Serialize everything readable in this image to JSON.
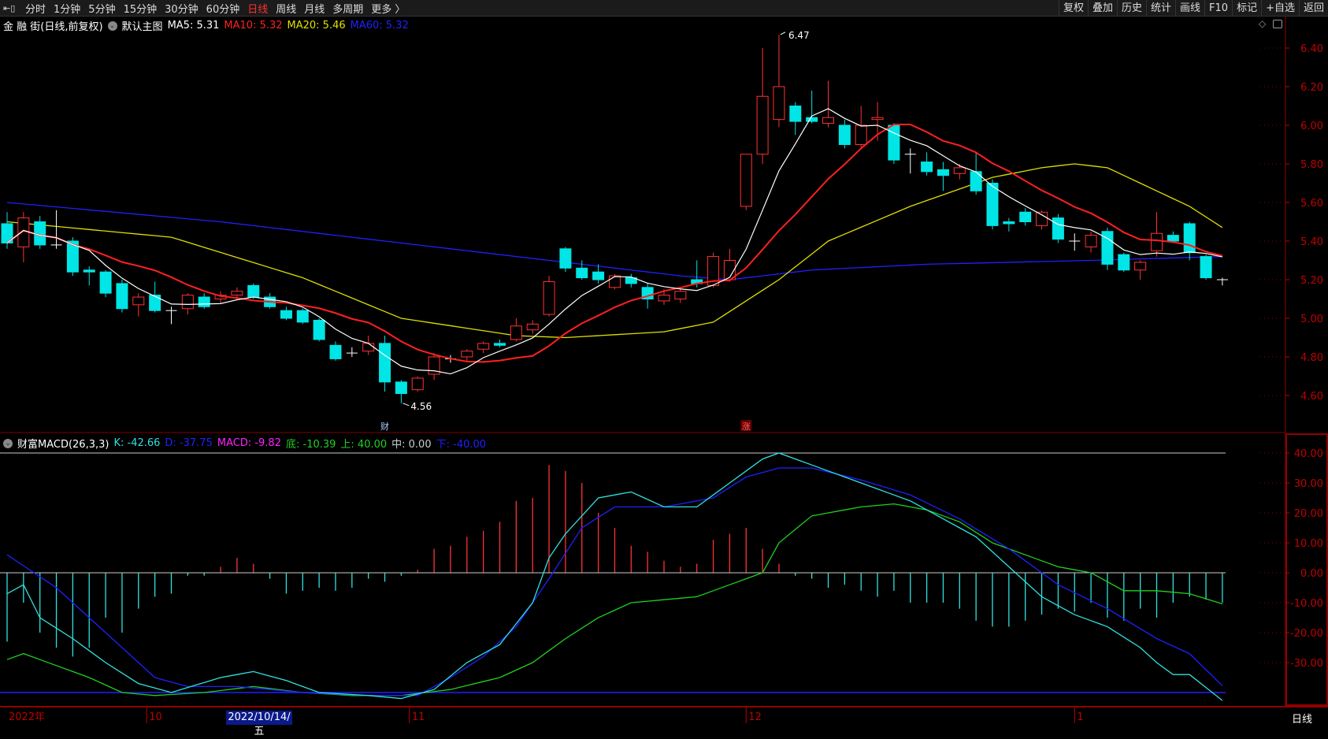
{
  "toolbar": {
    "periods": [
      "分时",
      "1分钟",
      "5分钟",
      "15分钟",
      "30分钟",
      "60分钟",
      "日线",
      "周线",
      "月线",
      "多周期",
      "更多 〉"
    ],
    "active": "日线",
    "buttons": [
      "复权",
      "叠加",
      "历史",
      "统计",
      "画线",
      "F10",
      "标记",
      "+自选",
      "返回"
    ]
  },
  "legend": {
    "title": "金 融 街(日线,前复权)",
    "main_label": "默认主图",
    "ma5": "MA5: 5.31",
    "ma10": "MA10: 5.32",
    "ma20": "MA20: 5.46",
    "ma60": "MA60: 5.32"
  },
  "macd_legend": {
    "title": "财富MACD(26,3,3)",
    "k": "K: -42.66",
    "d": "D: -37.75",
    "macd": "MACD: -9.82",
    "di": "底: -10.39",
    "up": "上: 40.00",
    "mid": "中: 0.00",
    "down": "下: -40.00"
  },
  "colors": {
    "up": "#ff3232",
    "down": "#00e5e5",
    "ma5": "#ffffff",
    "ma10": "#ff2020",
    "ma20": "#e0e000",
    "ma60": "#2020ff",
    "k": "#30e0e0",
    "d": "#2020ff",
    "di": "#20d020",
    "axis": "#c00000"
  },
  "xaxis": {
    "labels": [
      "2022年",
      "10",
      "11",
      "12",
      "1"
    ],
    "label_index": [
      0,
      8.5,
      24.5,
      45,
      65
    ],
    "cursor_date": "2022/10/14/五",
    "period": "日线"
  },
  "chart_data": {
    "type": "candlestick",
    "price_ticks": [
      "6.40",
      "6.20",
      "6.00",
      "5.80",
      "5.60",
      "5.40",
      "5.20",
      "5.00",
      "4.80",
      "4.60"
    ],
    "macd_ticks": [
      "40.00",
      "30.00",
      "20.00",
      "10.00",
      "0.00",
      "-10.00",
      "-20.00",
      "-30.00"
    ],
    "high_label": "6.47",
    "low_label": "4.56",
    "markers": [
      {
        "index": 23,
        "text": "财"
      },
      {
        "index": 45,
        "text": "涨"
      }
    ],
    "ohlc": [
      [
        5.49,
        5.55,
        5.36,
        5.39
      ],
      [
        5.37,
        5.55,
        5.29,
        5.52
      ],
      [
        5.5,
        5.53,
        5.36,
        5.38
      ],
      [
        5.38,
        5.56,
        5.36,
        5.38
      ],
      [
        5.4,
        5.42,
        5.22,
        5.24
      ],
      [
        5.25,
        5.27,
        5.17,
        5.24
      ],
      [
        5.24,
        5.25,
        5.11,
        5.13
      ],
      [
        5.18,
        5.2,
        5.03,
        5.05
      ],
      [
        5.07,
        5.13,
        5.01,
        5.11
      ],
      [
        5.12,
        5.19,
        5.03,
        5.04
      ],
      [
        5.04,
        5.06,
        4.97,
        5.04
      ],
      [
        5.05,
        5.13,
        5.02,
        5.12
      ],
      [
        5.11,
        5.13,
        5.05,
        5.06
      ],
      [
        5.1,
        5.14,
        5.08,
        5.12
      ],
      [
        5.12,
        5.16,
        5.1,
        5.14
      ],
      [
        5.17,
        5.18,
        5.1,
        5.11
      ],
      [
        5.11,
        5.13,
        5.05,
        5.06
      ],
      [
        5.04,
        5.06,
        4.99,
        5.0
      ],
      [
        5.04,
        5.05,
        4.97,
        4.98
      ],
      [
        4.99,
        5.0,
        4.88,
        4.89
      ],
      [
        4.86,
        4.88,
        4.78,
        4.79
      ],
      [
        4.82,
        4.85,
        4.8,
        4.82
      ],
      [
        4.83,
        4.91,
        4.81,
        4.87
      ],
      [
        4.87,
        4.91,
        4.62,
        4.67
      ],
      [
        4.67,
        4.68,
        4.56,
        4.61
      ],
      [
        4.63,
        4.7,
        4.62,
        4.69
      ],
      [
        4.71,
        4.82,
        4.68,
        4.8
      ],
      [
        4.79,
        4.81,
        4.77,
        4.79
      ],
      [
        4.8,
        4.84,
        4.78,
        4.83
      ],
      [
        4.84,
        4.88,
        4.82,
        4.87
      ],
      [
        4.87,
        4.89,
        4.85,
        4.86
      ],
      [
        4.89,
        5.0,
        4.88,
        4.96
      ],
      [
        4.94,
        4.99,
        4.92,
        4.97
      ],
      [
        5.02,
        5.22,
        5.01,
        5.19
      ],
      [
        5.36,
        5.37,
        5.24,
        5.26
      ],
      [
        5.26,
        5.3,
        5.2,
        5.21
      ],
      [
        5.24,
        5.28,
        5.18,
        5.2
      ],
      [
        5.16,
        5.23,
        5.15,
        5.22
      ],
      [
        5.21,
        5.23,
        5.16,
        5.18
      ],
      [
        5.16,
        5.18,
        5.05,
        5.1
      ],
      [
        5.09,
        5.15,
        5.07,
        5.12
      ],
      [
        5.1,
        5.16,
        5.08,
        5.14
      ],
      [
        5.2,
        5.3,
        5.16,
        5.18
      ],
      [
        5.17,
        5.34,
        5.16,
        5.32
      ],
      [
        5.2,
        5.36,
        5.19,
        5.3
      ],
      [
        5.58,
        5.85,
        5.56,
        5.85
      ],
      [
        5.85,
        6.4,
        5.8,
        6.15
      ],
      [
        6.03,
        6.47,
        5.99,
        6.2
      ],
      [
        6.1,
        6.12,
        5.95,
        6.02
      ],
      [
        6.04,
        6.18,
        6.01,
        6.02
      ],
      [
        6.01,
        6.23,
        5.99,
        6.04
      ],
      [
        6.0,
        6.03,
        5.88,
        5.9
      ],
      [
        5.9,
        6.1,
        5.88,
        6.0
      ],
      [
        6.03,
        6.12,
        5.92,
        6.04
      ],
      [
        6.0,
        6.01,
        5.8,
        5.82
      ],
      [
        5.85,
        5.88,
        5.75,
        5.85
      ],
      [
        5.81,
        5.86,
        5.74,
        5.76
      ],
      [
        5.77,
        5.81,
        5.66,
        5.74
      ],
      [
        5.75,
        5.8,
        5.72,
        5.78
      ],
      [
        5.76,
        5.86,
        5.64,
        5.66
      ],
      [
        5.7,
        5.72,
        5.46,
        5.48
      ],
      [
        5.5,
        5.52,
        5.45,
        5.49
      ],
      [
        5.55,
        5.57,
        5.48,
        5.5
      ],
      [
        5.48,
        5.56,
        5.46,
        5.55
      ],
      [
        5.52,
        5.54,
        5.39,
        5.41
      ],
      [
        5.4,
        5.44,
        5.35,
        5.4
      ],
      [
        5.37,
        5.45,
        5.34,
        5.43
      ],
      [
        5.45,
        5.47,
        5.25,
        5.28
      ],
      [
        5.33,
        5.34,
        5.24,
        5.25
      ],
      [
        5.25,
        5.3,
        5.2,
        5.29
      ],
      [
        5.35,
        5.55,
        5.32,
        5.44
      ],
      [
        5.43,
        5.45,
        5.39,
        5.4
      ],
      [
        5.49,
        5.5,
        5.3,
        5.34
      ],
      [
        5.32,
        5.33,
        5.2,
        5.21
      ],
      [
        5.2,
        5.21,
        5.17,
        5.2
      ]
    ],
    "ma20": [
      [
        0,
        5.5
      ],
      [
        10,
        5.42
      ],
      [
        18,
        5.21
      ],
      [
        24,
        5.0
      ],
      [
        31,
        4.91
      ],
      [
        34,
        4.9
      ],
      [
        40,
        4.93
      ],
      [
        43,
        4.98
      ],
      [
        47,
        5.2
      ],
      [
        50,
        5.4
      ],
      [
        55,
        5.58
      ],
      [
        60,
        5.73
      ],
      [
        63,
        5.78
      ],
      [
        65,
        5.8
      ],
      [
        67,
        5.78
      ],
      [
        69,
        5.7
      ],
      [
        72,
        5.58
      ],
      [
        74,
        5.47
      ]
    ],
    "ma60": [
      [
        0,
        5.6
      ],
      [
        13,
        5.5
      ],
      [
        23,
        5.4
      ],
      [
        33,
        5.3
      ],
      [
        41,
        5.22
      ],
      [
        44,
        5.2
      ],
      [
        49,
        5.25
      ],
      [
        56,
        5.28
      ],
      [
        66,
        5.3
      ],
      [
        74,
        5.32
      ]
    ],
    "macd_hist": [
      -23,
      -10,
      -20,
      -25,
      -28,
      -25,
      -15,
      -20,
      -12,
      -8,
      -7,
      -1,
      -1,
      2,
      5,
      3,
      -2,
      -7,
      -6,
      -5,
      -6,
      -5,
      -2,
      -3,
      -1,
      1,
      8,
      9,
      12,
      14,
      17,
      24,
      25,
      36,
      34,
      30,
      20,
      15,
      9,
      7,
      4,
      2,
      3,
      11,
      13,
      15,
      8,
      3,
      -1,
      -2,
      -5,
      -4,
      -6,
      -8,
      -6,
      -10,
      -10,
      -10,
      -12,
      -16,
      -18,
      -18,
      -16,
      -14,
      -12,
      -13,
      -10,
      -15,
      -16,
      -12,
      -15,
      -10,
      -8,
      -9,
      -10
    ],
    "k": [
      [
        0,
        -7
      ],
      [
        1,
        -4
      ],
      [
        2,
        -15
      ],
      [
        4,
        -22
      ],
      [
        6,
        -30
      ],
      [
        8,
        -37
      ],
      [
        10,
        -40
      ],
      [
        13,
        -35
      ],
      [
        15,
        -33
      ],
      [
        17,
        -36
      ],
      [
        19,
        -40
      ],
      [
        22,
        -41
      ],
      [
        24,
        -42
      ],
      [
        26,
        -39
      ],
      [
        28,
        -30
      ],
      [
        30,
        -24
      ],
      [
        32,
        -10
      ],
      [
        33,
        5
      ],
      [
        34,
        13
      ],
      [
        36,
        25
      ],
      [
        38,
        27
      ],
      [
        40,
        22
      ],
      [
        42,
        22
      ],
      [
        44,
        30
      ],
      [
        46,
        38
      ],
      [
        47,
        40
      ],
      [
        49,
        36
      ],
      [
        51,
        32
      ],
      [
        53,
        28
      ],
      [
        55,
        24
      ],
      [
        57,
        18
      ],
      [
        59,
        12
      ],
      [
        61,
        2
      ],
      [
        63,
        -8
      ],
      [
        65,
        -14
      ],
      [
        67,
        -18
      ],
      [
        69,
        -25
      ],
      [
        70,
        -30
      ],
      [
        71,
        -34
      ],
      [
        72,
        -34
      ],
      [
        74,
        -42.66
      ]
    ],
    "d": [
      [
        0,
        6
      ],
      [
        3,
        -5
      ],
      [
        6,
        -20
      ],
      [
        9,
        -35
      ],
      [
        11,
        -38
      ],
      [
        14,
        -38
      ],
      [
        18,
        -40
      ],
      [
        22,
        -41
      ],
      [
        25,
        -41
      ],
      [
        27,
        -35
      ],
      [
        29,
        -28
      ],
      [
        31,
        -18
      ],
      [
        33,
        -2
      ],
      [
        35,
        15
      ],
      [
        37,
        22
      ],
      [
        40,
        22
      ],
      [
        43,
        25
      ],
      [
        45,
        32
      ],
      [
        47,
        35
      ],
      [
        49,
        35
      ],
      [
        52,
        31
      ],
      [
        55,
        26
      ],
      [
        58,
        18
      ],
      [
        61,
        8
      ],
      [
        64,
        -4
      ],
      [
        67,
        -12
      ],
      [
        70,
        -22
      ],
      [
        72,
        -27
      ],
      [
        74,
        -37.75
      ]
    ],
    "di": [
      [
        0,
        -29
      ],
      [
        1,
        -27
      ],
      [
        3,
        -31
      ],
      [
        5,
        -35
      ],
      [
        7,
        -40
      ],
      [
        9,
        -41
      ],
      [
        12,
        -40
      ],
      [
        15,
        -38
      ],
      [
        18,
        -40
      ],
      [
        21,
        -41
      ],
      [
        24,
        -41
      ],
      [
        27,
        -39
      ],
      [
        30,
        -35
      ],
      [
        32,
        -30
      ],
      [
        34,
        -22
      ],
      [
        36,
        -15
      ],
      [
        38,
        -10
      ],
      [
        40,
        -9
      ],
      [
        42,
        -8
      ],
      [
        44,
        -4
      ],
      [
        46,
        0
      ],
      [
        47,
        10
      ],
      [
        49,
        19
      ],
      [
        52,
        22
      ],
      [
        54,
        23
      ],
      [
        56,
        21
      ],
      [
        58,
        17
      ],
      [
        60,
        10
      ],
      [
        62,
        6
      ],
      [
        64,
        2
      ],
      [
        66,
        0
      ],
      [
        68,
        -6
      ],
      [
        70,
        -6
      ],
      [
        72,
        -7
      ],
      [
        74,
        -10.39
      ]
    ],
    "hlines": [
      40,
      -40
    ]
  }
}
